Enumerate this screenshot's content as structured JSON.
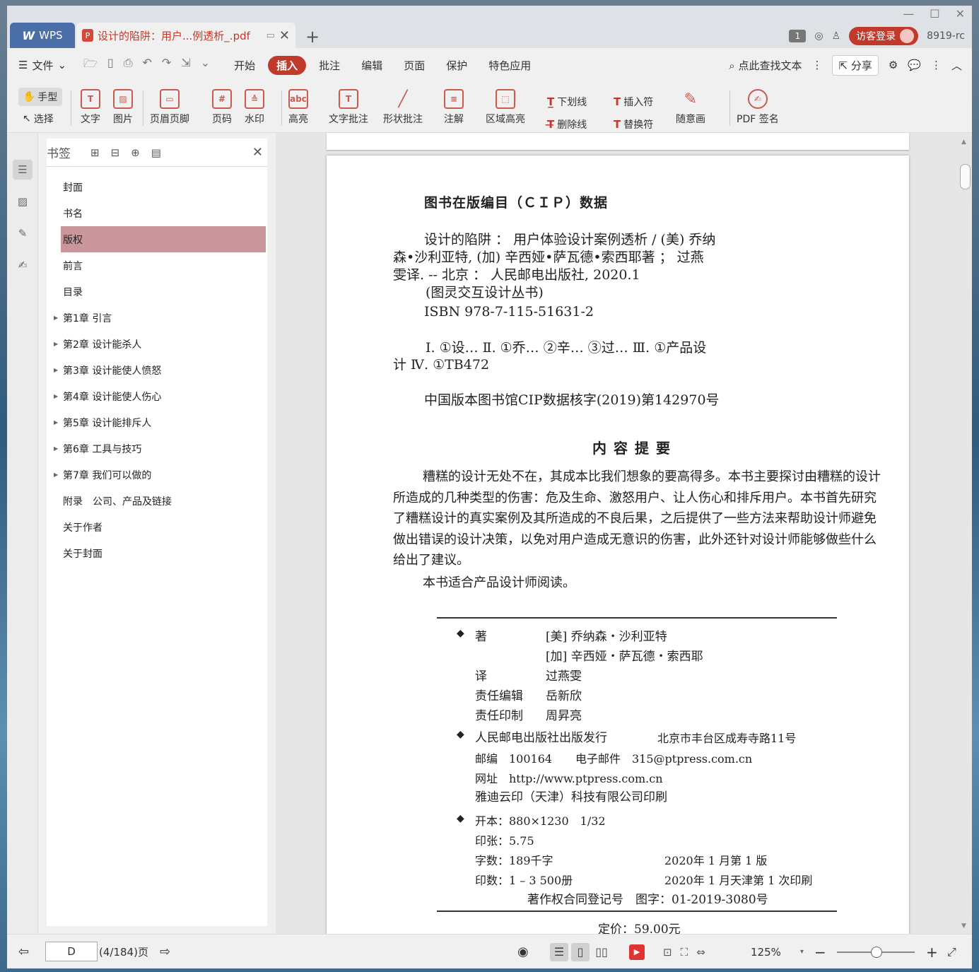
{
  "tabs": {
    "home_label": "WPS",
    "doc_title": "设计的陷阱：用户...例透析_.pdf",
    "pdf_icon": "P"
  },
  "title_right": {
    "badge": "1",
    "login_label": "访客登录",
    "user_code": "8919-rc"
  },
  "menu": {
    "file_label": "文件",
    "tabs": [
      "开始",
      "插入",
      "批注",
      "编辑",
      "页面",
      "保护",
      "特色应用"
    ],
    "active_tab": "插入",
    "search_label": "点此查找文本",
    "share_label": "分享"
  },
  "ribbon": {
    "hand": "手型",
    "select": "选择",
    "text": "文字",
    "image": "图片",
    "header_footer": "页眉页脚",
    "page_number": "页码",
    "watermark": "水印",
    "highlight": "高亮",
    "text_annotation": "文字批注",
    "shape_annotation": "形状批注",
    "note": "注解",
    "area_highlight": "区域高亮",
    "underline": "下划线",
    "strikethrough": "删除线",
    "insert_mark": "插入符",
    "replace_mark": "替换符",
    "freehand": "随意画",
    "pdf_sign": "PDF 签名",
    "abc": "abc",
    "hash": "#"
  },
  "bookmarks": {
    "title": "书签",
    "items": [
      {
        "label": "封面",
        "expandable": false
      },
      {
        "label": "书名",
        "expandable": false
      },
      {
        "label": "版权",
        "expandable": false,
        "selected": true
      },
      {
        "label": "前言",
        "expandable": false
      },
      {
        "label": "目录",
        "expandable": false
      },
      {
        "label": "第1章 引言",
        "expandable": true
      },
      {
        "label": "第2章 设计能杀人",
        "expandable": true
      },
      {
        "label": "第3章 设计能使人愤怒",
        "expandable": true
      },
      {
        "label": "第4章 设计能使人伤心",
        "expandable": true
      },
      {
        "label": "第5章 设计能排斥人",
        "expandable": true
      },
      {
        "label": "第6章 工具与技巧",
        "expandable": true
      },
      {
        "label": "第7章 我们可以做的",
        "expandable": true
      },
      {
        "label": "附录　公司、产品及链接",
        "expandable": false
      },
      {
        "label": "关于作者",
        "expandable": false
      },
      {
        "label": "关于封面",
        "expandable": false
      }
    ]
  },
  "page": {
    "cip_title": "图书在版编目（ＣＩＰ）数据",
    "cip_line1": "设计的陷阱 ： 用户体验设计案例透析 / (美) 乔纳",
    "cip_line2": "森•沙利亚特, (加) 辛西娅•萨瓦德•索西耶著 ； 过燕",
    "cip_line3": "雯译. -- 北京 ： 人民邮电出版社, 2020.1",
    "cip_line4": "(图灵交互设计丛书)",
    "cip_line5": "ISBN 978-7-115-51631-2",
    "cip_line6": "Ⅰ. ①设… Ⅱ. ①乔… ②辛… ③过… Ⅲ. ①产品设",
    "cip_line7": "计 Ⅳ. ①TB472",
    "cip_number": "中国版本图书馆CIP数据核字(2019)第142970号",
    "summary_heading": "内容提要",
    "summary_p1": "糟糕的设计无处不在，其成本比我们想象的要高得多。本书主要探讨由糟糕的设计所造成的几种类型的伤害：危及生命、激怒用户、让人伤心和排斥用户。本书首先研究了糟糕设计的真实案例及其所造成的不良后果，之后提供了一些方法来帮助设计师避免做出错误的设计决策，以免对用户造成无意识的伤害，此外还针对设计师能够做些什么给出了建议。",
    "summary_p2": "本书适合产品设计师阅读。",
    "bullet": "◆",
    "author_label": "著",
    "author1": "[美] 乔纳森・沙利亚特",
    "author2": "[加] 辛西娅・萨瓦德・索西耶",
    "translator_label": "译",
    "translator": "过燕雯",
    "editor_label": "责任编辑",
    "editor": "岳新欣",
    "print_label": "责任印制",
    "print": "周昇亮",
    "publisher": "人民邮电出版社出版发行",
    "address": "北京市丰台区成寿寺路11号",
    "zip": "邮编　100164",
    "email": "电子邮件　315@ptpress.com.cn",
    "website": "网址　http://www.ptpress.com.cn",
    "printer": "雅迪云印（天津）科技有限公司印刷",
    "format": "开本：880×1230　1/32",
    "sheets": "印张：5.75",
    "words": "字数：189千字",
    "edition": "2020年 1 月第 1 版",
    "copies": "印数：1 – 3 500册",
    "printing": "2020年 1 月天津第 1 次印刷",
    "copyright_reg": "著作权合同登记号　图字：01-2019-3080号",
    "price": "定价：59.00元"
  },
  "status": {
    "page_value": "D",
    "page_count": "(4/184)",
    "page_unit": "页",
    "zoom": "125%"
  }
}
